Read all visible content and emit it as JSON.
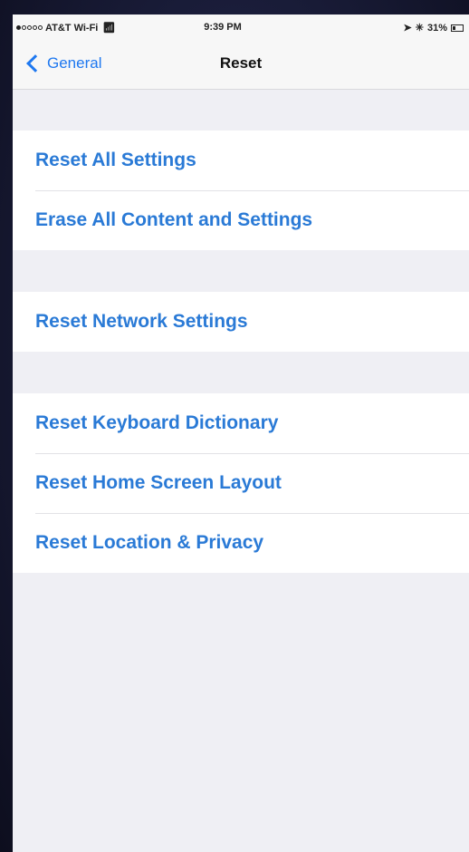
{
  "status_bar": {
    "carrier": "AT&T Wi-Fi",
    "time": "9:39 PM",
    "battery_text": "31%",
    "battery_level": 0.31
  },
  "nav": {
    "back_label": "General",
    "title": "Reset"
  },
  "groups": [
    {
      "items": [
        "Reset All Settings",
        "Erase All Content and Settings"
      ]
    },
    {
      "items": [
        "Reset Network Settings"
      ]
    },
    {
      "items": [
        "Reset Keyboard Dictionary",
        "Reset Home Screen Layout",
        "Reset Location & Privacy"
      ]
    }
  ],
  "colors": {
    "accent": "#2a7ad6",
    "background": "#efeff4"
  }
}
